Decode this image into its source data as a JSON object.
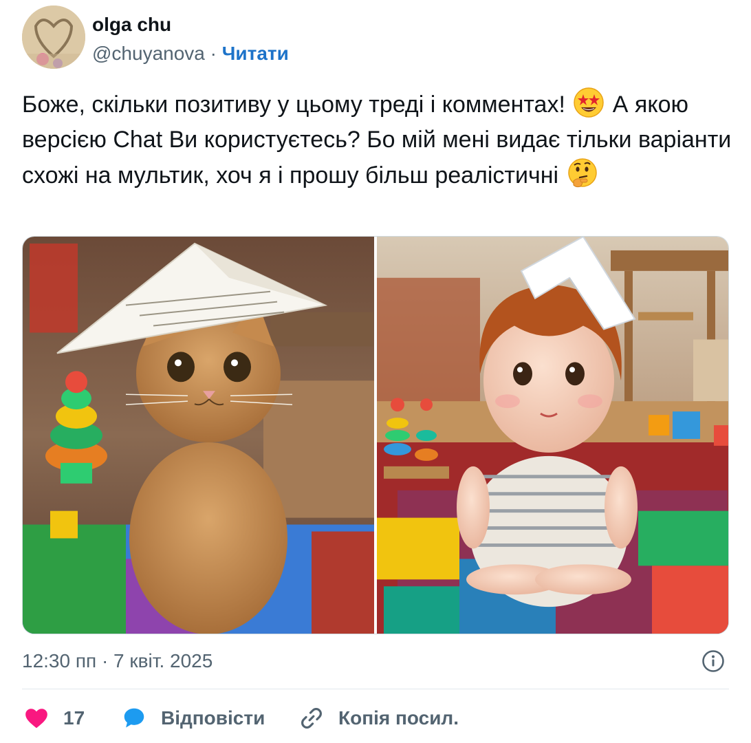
{
  "author": {
    "name": "olga chu",
    "handle": "@chuyanova",
    "separator": " · ",
    "follow_label": "Читати"
  },
  "tweet": {
    "text_part1": "Боже, скільки позитиву у цьому треді і комментах!",
    "text_part2": " А якою версією Chat Ви користуєтесь? Бо мій мені видає тільки варіанти схожі на мультик, хоч я і прошу більш реалістичні",
    "emoji1": "star-struck-emoji",
    "emoji2": "thinking-face-emoji"
  },
  "media": {
    "images": [
      {
        "name": "cat-in-paper-hat-photo"
      },
      {
        "name": "toddler-in-paper-hat-illustration"
      }
    ]
  },
  "meta": {
    "timestamp": "12:30 пп · 7 квіт. 2025"
  },
  "actions": {
    "like_count": "17",
    "reply_label": "Відповісти",
    "copy_link_label": "Копія посил."
  },
  "colors": {
    "accent": "#1d73c9",
    "like": "#f91880",
    "reply_icon": "#1d9bf0",
    "muted_text": "#536471"
  },
  "icons": [
    "heart-icon",
    "reply-bubble-icon",
    "link-icon",
    "info-icon"
  ]
}
